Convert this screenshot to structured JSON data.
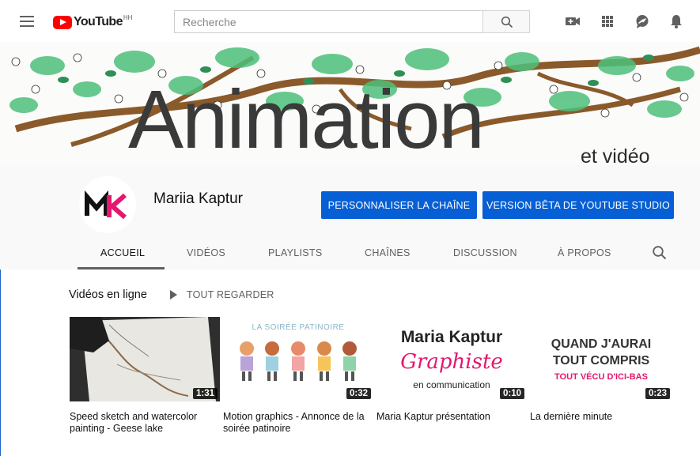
{
  "header": {
    "logo_text": "YouTube",
    "logo_region": "HH",
    "search_placeholder": "Recherche"
  },
  "banner": {
    "title": "Animation",
    "subtitle": "et vidéo"
  },
  "channel": {
    "name": "Mariia Kaptur",
    "avatar_text": "MK",
    "customize_button": "PERSONNALISER LA CHAÎNE",
    "studio_button": "VERSION BÊTA DE YOUTUBE STUDIO"
  },
  "tabs": [
    "ACCUEIL",
    "VIDÉOS",
    "PLAYLISTS",
    "CHAÎNES",
    "DISCUSSION",
    "À PROPOS"
  ],
  "section": {
    "title": "Vidéos en ligne",
    "play_all": "TOUT REGARDER"
  },
  "videos": [
    {
      "title": "Speed sketch and watercolor painting - Geese lake",
      "duration": "1:31"
    },
    {
      "title": "Motion graphics - Annonce de la soirée patinoire",
      "duration": "0:32",
      "thumb_text": "LA SOIRÉE PATINOIRE"
    },
    {
      "title": "Maria Kaptur présentation",
      "duration": "0:10",
      "thumb_line1": "Maria Kaptur",
      "thumb_line2": "Graphiste",
      "thumb_line3": "en communication"
    },
    {
      "title": "La dernière minute",
      "duration": "0:23",
      "thumb_line1": "QUAND J'AURAI",
      "thumb_line2": "TOUT COMPRIS",
      "thumb_line3": "TOUT VÉCU D'ICI-BAS"
    }
  ],
  "colors": {
    "brand_red": "#ff0000",
    "button_blue": "#065fd4",
    "leaf_green": "#4ec07a",
    "brown": "#8a5a2b",
    "avatar_magenta": "#e5176e"
  }
}
